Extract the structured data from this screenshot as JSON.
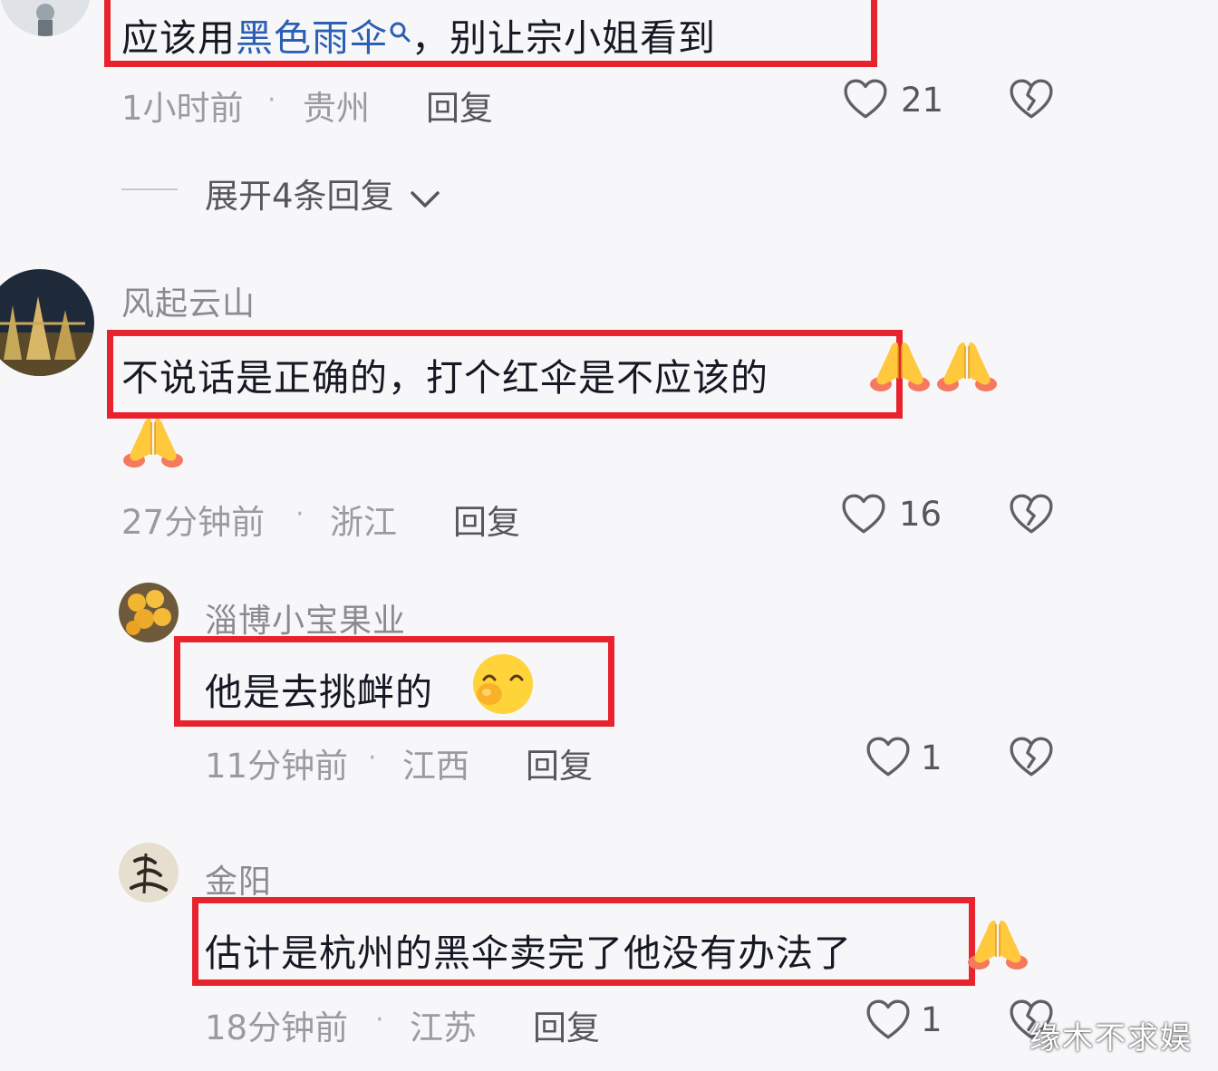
{
  "comments": [
    {
      "text_before": "应该用",
      "text_link": "黑色雨伞",
      "text_after": "，别让宗小姐看到",
      "time": "1小时前",
      "location": "贵州",
      "reply_label": "回复",
      "likes": "21"
    },
    {
      "username": "风起云山",
      "text": "不说话是正确的，打个红伞是不应该的",
      "time": "27分钟前",
      "location": "浙江",
      "reply_label": "回复",
      "likes": "16"
    },
    {
      "username": "淄博小宝果业",
      "text": "他是去挑衅的",
      "time": "11分钟前",
      "location": "江西",
      "reply_label": "回复",
      "likes": "1"
    },
    {
      "username": "金阳",
      "text": "估计是杭州的黑伞卖完了他没有办法了",
      "time": "18分钟前",
      "location": "江苏",
      "reply_label": "回复",
      "likes": "1"
    }
  ],
  "expand_replies": "展开4条回复",
  "separator": "·",
  "watermark": "缘木不求娱",
  "colors": {
    "highlight_box": "#e8232e",
    "link": "#2b5fb4"
  },
  "icons": [
    "search-icon",
    "heart-icon",
    "broken-heart-icon",
    "chevron-down-icon",
    "praying-hands-emoji",
    "shy-face-emoji"
  ]
}
